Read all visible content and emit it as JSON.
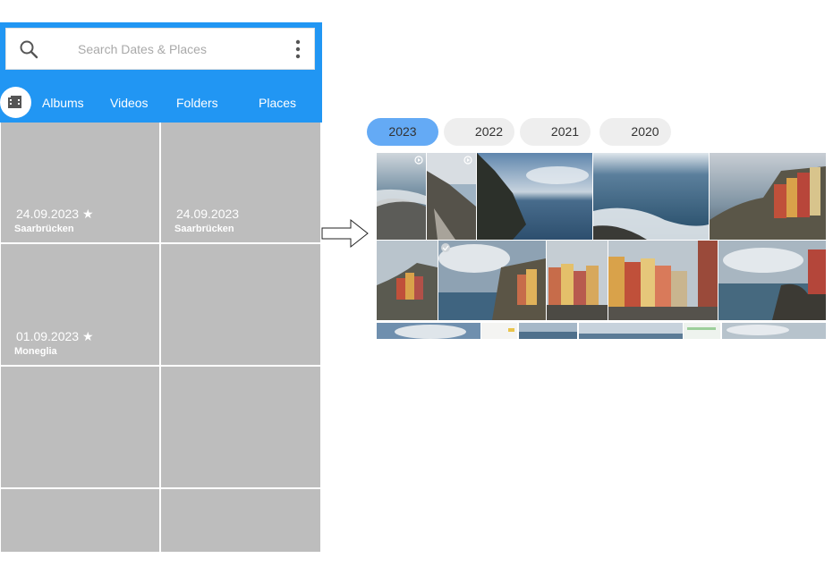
{
  "search": {
    "placeholder": "Search Dates & Places",
    "icon": "search-icon",
    "menu_icon": "more-vertical-icon"
  },
  "nav": {
    "album_icon": "film-folder-icon",
    "tabs": [
      "Albums",
      "Videos",
      "Folders",
      "Places"
    ]
  },
  "grid": {
    "cells": [
      {
        "date": "24.09.2023 ★",
        "place": "Saarbrücken"
      },
      {
        "date": "24.09.2023",
        "place": "Saarbrücken"
      },
      {
        "date": "01.09.2023 ★",
        "place": "Moneglia"
      },
      {
        "date": "",
        "place": ""
      },
      {
        "date": "",
        "place": ""
      },
      {
        "date": "",
        "place": ""
      },
      {
        "date": "",
        "place": ""
      },
      {
        "date": "",
        "place": ""
      }
    ]
  },
  "gallery": {
    "years": [
      "2023",
      "2022",
      "2021",
      "2020"
    ],
    "selected_year": "2023",
    "photos": [
      "sea-rocks-video",
      "coastal-path-video",
      "cliff-sea",
      "ocean-waves",
      "riomaggiore-village",
      "village-rocks",
      "village-cliff",
      "harbor-village",
      "colorful-houses",
      "coast-village-right",
      "sky-strip",
      "screenshot-thumb",
      "sea-strip",
      "horizon-strip",
      "screenshot-thumb-2",
      "cloud-strip"
    ]
  },
  "colors": {
    "accent": "#2196f3",
    "placeholder_tile": "#bdbdbd",
    "year_selected": "#64aaf5",
    "year_default": "#eeeeee"
  }
}
